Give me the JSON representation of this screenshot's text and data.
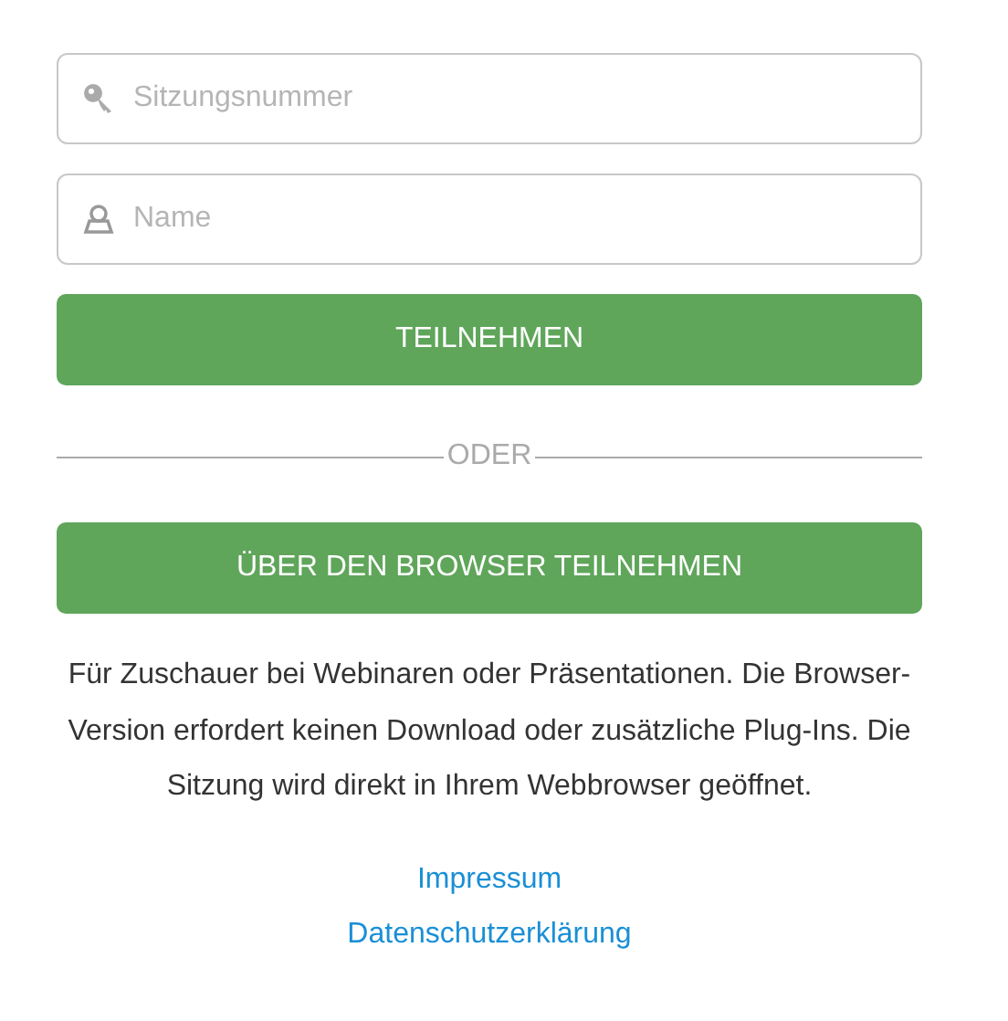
{
  "fields": [
    {
      "kind": "key",
      "placeholder": "Sitzungsnummer"
    },
    {
      "kind": "user",
      "placeholder": "Name"
    }
  ],
  "join_button": "TEILNEHMEN",
  "divider": "ODER",
  "browser_button": "ÜBER DEN BROWSER TEILNEHMEN",
  "description": "Für Zuschauer bei Webinaren oder Präsentationen. Die Browser-Version erfordert keinen Download oder zusätzliche Plug-Ins. Die Sitzung wird direkt in Ihrem Webbrowser geöffnet.",
  "links": [
    "Impressum",
    "Datenschutzerklärung"
  ]
}
